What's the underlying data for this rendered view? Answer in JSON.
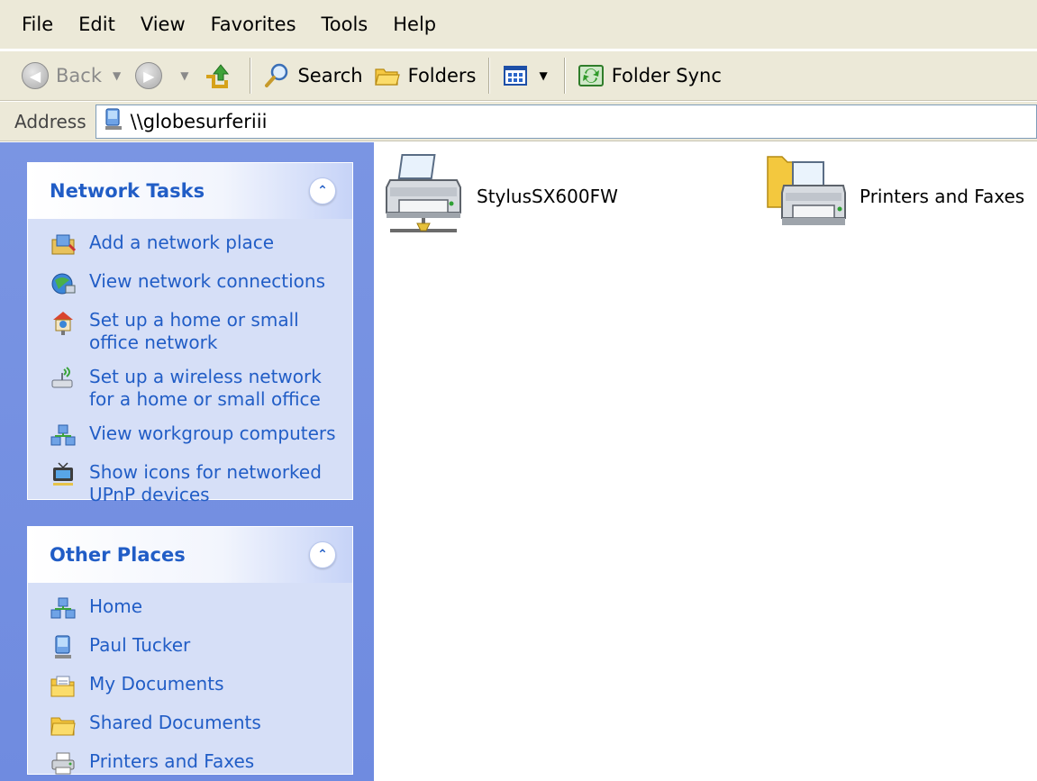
{
  "menu": [
    "File",
    "Edit",
    "View",
    "Favorites",
    "Tools",
    "Help"
  ],
  "toolbar": {
    "back_label": "Back",
    "search_label": "Search",
    "folders_label": "Folders",
    "folder_sync_label": "Folder Sync"
  },
  "address": {
    "label": "Address",
    "value": "\\\\globesurferiii"
  },
  "network_tasks": {
    "title": "Network Tasks",
    "items": [
      {
        "label": "Add a network place",
        "icon": "add-network-place-icon"
      },
      {
        "label": "View network connections",
        "icon": "network-connections-icon"
      },
      {
        "label": "Set up a home or small office network",
        "icon": "home-network-icon"
      },
      {
        "label": "Set up a wireless network for a home or small office",
        "icon": "wireless-network-icon"
      },
      {
        "label": "View workgroup computers",
        "icon": "workgroup-computers-icon"
      },
      {
        "label": "Show icons for networked UPnP devices",
        "icon": "upnp-devices-icon"
      }
    ]
  },
  "other_places": {
    "title": "Other Places",
    "items": [
      {
        "label": "Home",
        "icon": "home-network-place-icon"
      },
      {
        "label": "Paul Tucker",
        "icon": "computer-icon"
      },
      {
        "label": "My Documents",
        "icon": "my-documents-icon"
      },
      {
        "label": "Shared Documents",
        "icon": "folder-icon"
      },
      {
        "label": "Printers and Faxes",
        "icon": "printers-faxes-icon"
      }
    ]
  },
  "content_items": [
    {
      "label": "StylusSX600FW",
      "icon": "network-printer-icon"
    },
    {
      "label": "Printers and Faxes",
      "icon": "printers-folder-icon"
    }
  ],
  "colors": {
    "taskpane_bg": "#7a95e3",
    "panel_bg": "#d6dff7",
    "link_blue": "#215dc6",
    "chrome_bg": "#ece9d8"
  }
}
